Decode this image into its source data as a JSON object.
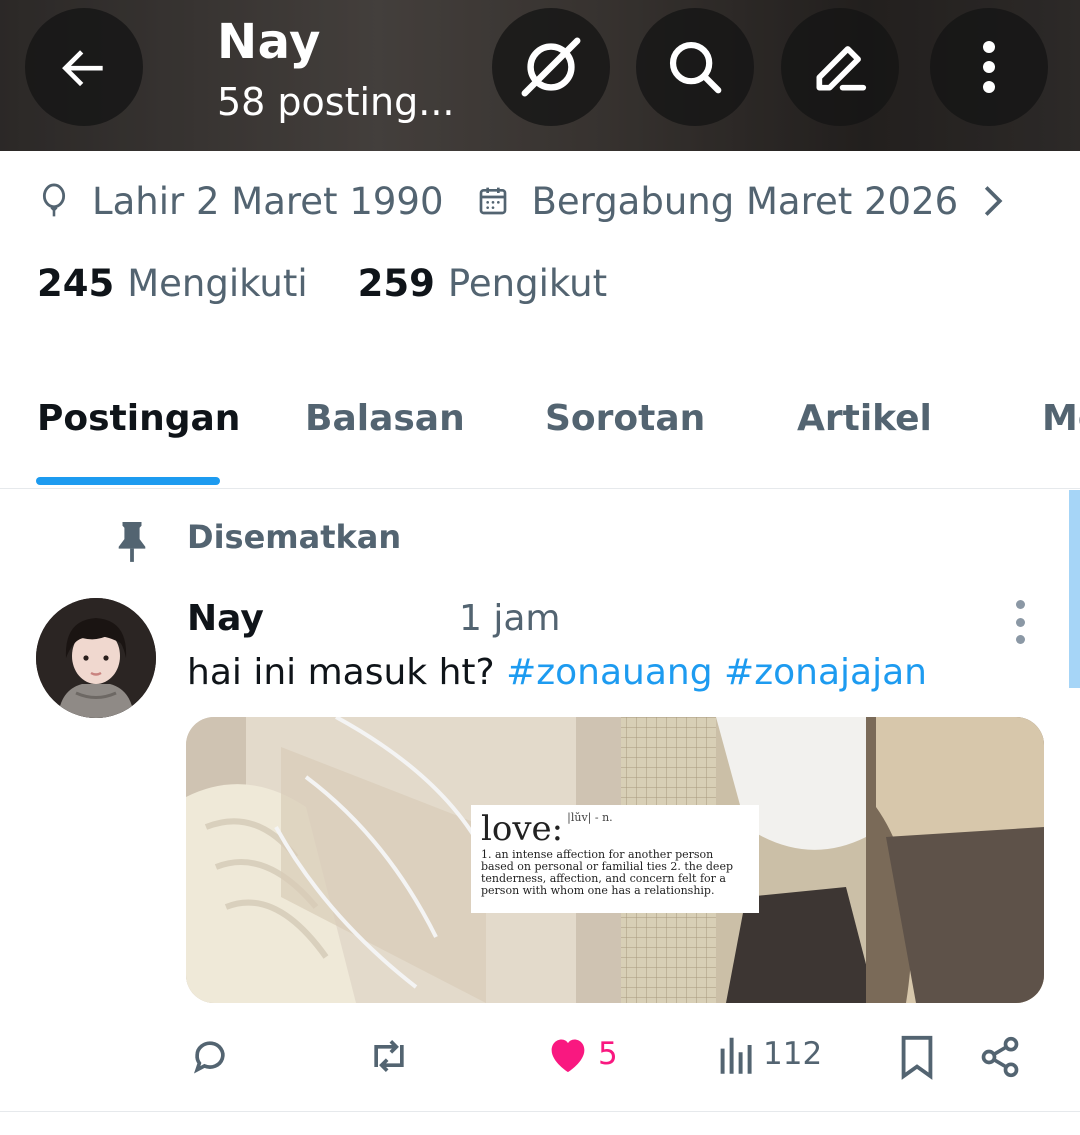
{
  "header": {
    "name": "Nay",
    "subtitle": "58 posting...",
    "buttons": [
      "back-icon",
      "grok-icon",
      "search-icon",
      "edit-icon",
      "more-vertical-icon"
    ]
  },
  "profile": {
    "birth": "Lahir 2 Maret 1990",
    "joined": "Bergabung Maret 2026",
    "following_count": "245",
    "following_label": "Mengikuti",
    "followers_count": "259",
    "followers_label": "Pengikut"
  },
  "tabs": [
    {
      "label": "Postingan",
      "active": true
    },
    {
      "label": "Balasan",
      "active": false
    },
    {
      "label": "Sorotan",
      "active": false
    },
    {
      "label": "Artikel",
      "active": false
    },
    {
      "label": "Me",
      "active": false
    }
  ],
  "post": {
    "pinned_label": "Disematkan",
    "author": "Nay",
    "time": "1 jam",
    "text": "hai ini masuk ht?",
    "hashtags": [
      "#zonauang",
      "#zonajajan"
    ],
    "media": {
      "word": "love:",
      "pron": "|lŭv| - n.",
      "definition": "1. an intense affection for another person based on personal or familial ties 2. the deep tenderness, affection, and concern felt for a person with whom one has a relationship."
    },
    "likes": "5",
    "views": "112"
  },
  "colors": {
    "accent": "#1d9bf0",
    "like": "#f91880",
    "muted": "#536471",
    "text": "#0f1419"
  }
}
